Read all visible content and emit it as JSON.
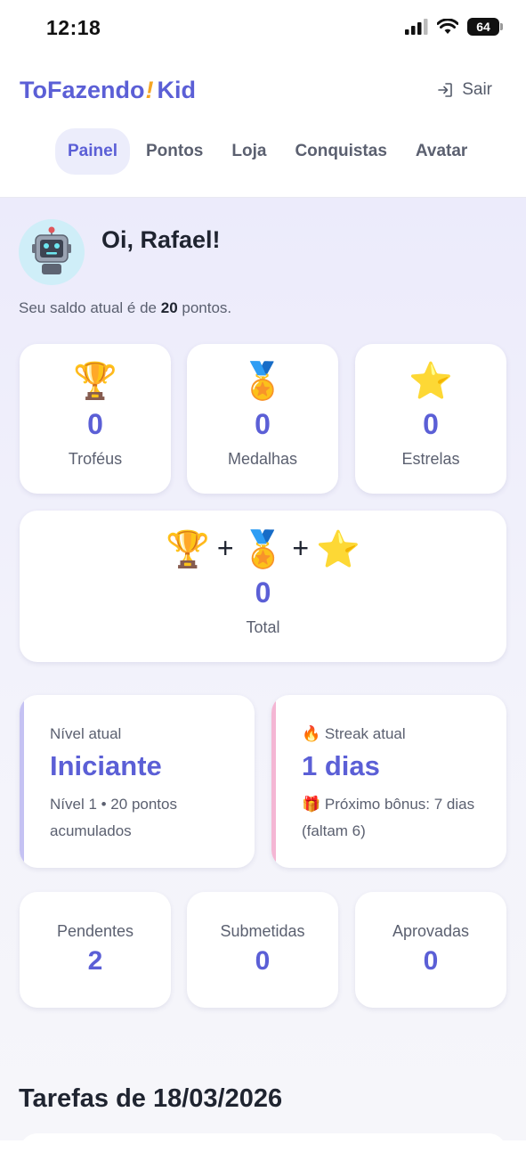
{
  "status_bar": {
    "time": "12:18",
    "battery": "64"
  },
  "header": {
    "brand_prefix": "ToFazendo",
    "brand_bang": "!",
    "brand_suffix": "Kid",
    "logout_label": "Sair"
  },
  "nav": {
    "tabs": [
      {
        "label": "Painel",
        "active": true
      },
      {
        "label": "Pontos"
      },
      {
        "label": "Loja"
      },
      {
        "label": "Conquistas"
      },
      {
        "label": "Avatar"
      }
    ]
  },
  "profile": {
    "greeting": "Oi, Rafael!",
    "balance_prefix": "Seu saldo atual é de ",
    "balance_points": "20",
    "balance_suffix": " pontos."
  },
  "awards": [
    {
      "icon": "trophy-icon",
      "emoji": "🏆",
      "value": "0",
      "label": "Troféus"
    },
    {
      "icon": "medal-icon",
      "emoji": "🏅",
      "value": "0",
      "label": "Medalhas"
    },
    {
      "icon": "star-icon",
      "emoji": "⭐",
      "value": "0",
      "label": "Estrelas"
    }
  ],
  "total": {
    "emoji_trophy": "🏆",
    "emoji_medal": "🏅",
    "emoji_star": "⭐",
    "plus": "+",
    "value": "0",
    "label": "Total"
  },
  "level": {
    "title": "Nível atual",
    "value": "Iniciante",
    "description": "Nível 1 • 20 pontos acumulados",
    "accent_color": "#c5c2f3"
  },
  "streak": {
    "icon_emoji": "🔥",
    "title": "Streak atual",
    "value": "1 dias",
    "bonus_emoji": "🎁",
    "bonus_text": "Próximo bônus: 7 dias (faltam 6)",
    "accent_color": "#f4b6d4"
  },
  "counts": [
    {
      "label": "Pendentes",
      "value": "2"
    },
    {
      "label": "Submetidas",
      "value": "0"
    },
    {
      "label": "Aprovadas",
      "value": "0"
    }
  ],
  "tasks": {
    "title": "Tarefas de 18/03/2026"
  },
  "colors": {
    "accent": "#5b5fd6",
    "brand_bang": "#f5a623"
  }
}
